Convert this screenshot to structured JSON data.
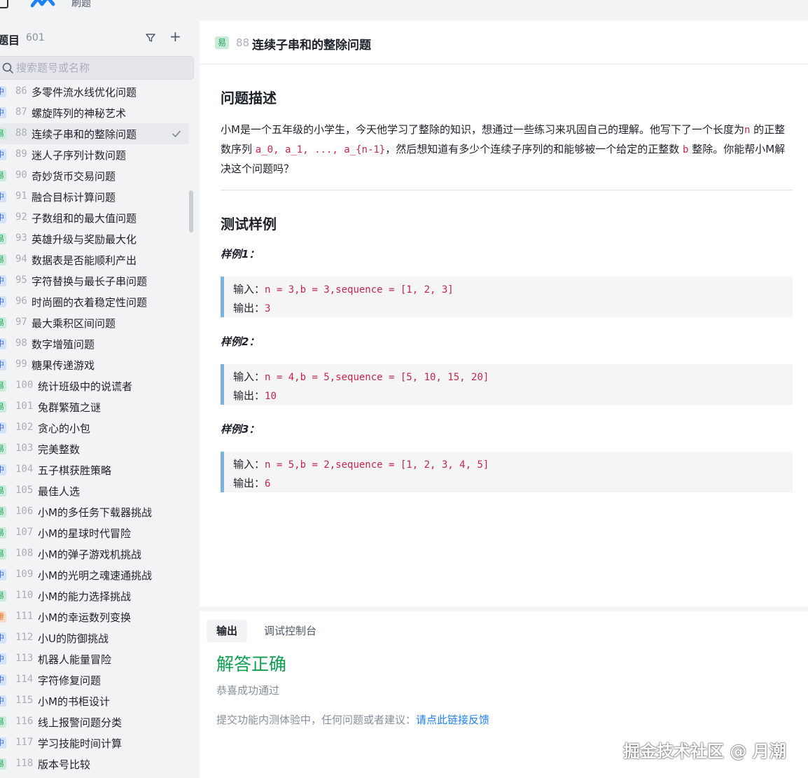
{
  "app": {
    "title": "刷题"
  },
  "sidebar": {
    "title": "题目",
    "count": "601",
    "search_placeholder": "搜索题号或名称",
    "items": [
      {
        "num": "86",
        "name": "多零件流水线优化问题",
        "diff": "中",
        "level": "mid"
      },
      {
        "num": "87",
        "name": "螺旋阵列的神秘艺术",
        "diff": "中",
        "level": "mid"
      },
      {
        "num": "88",
        "name": "连续子串和的整除问题",
        "diff": "易",
        "level": "easy",
        "active": true
      },
      {
        "num": "89",
        "name": "迷人子序列计数问题",
        "diff": "中",
        "level": "mid"
      },
      {
        "num": "90",
        "name": "奇妙货币交易问题",
        "diff": "易",
        "level": "easy"
      },
      {
        "num": "91",
        "name": "融合目标计算问题",
        "diff": "中",
        "level": "mid"
      },
      {
        "num": "92",
        "name": "子数组和的最大值问题",
        "diff": "中",
        "level": "mid"
      },
      {
        "num": "93",
        "name": "英雄升级与奖励最大化",
        "diff": "易",
        "level": "easy"
      },
      {
        "num": "94",
        "name": "数据表是否能顺利产出",
        "diff": "易",
        "level": "easy"
      },
      {
        "num": "95",
        "name": "字符替换与最长子串问题",
        "diff": "中",
        "level": "mid"
      },
      {
        "num": "96",
        "name": "时尚圈的衣着稳定性问题",
        "diff": "中",
        "level": "mid"
      },
      {
        "num": "97",
        "name": "最大乘积区间问题",
        "diff": "易",
        "level": "easy"
      },
      {
        "num": "98",
        "name": "数字增殖问题",
        "diff": "中",
        "level": "mid"
      },
      {
        "num": "99",
        "name": "糖果传递游戏",
        "diff": "中",
        "level": "mid"
      },
      {
        "num": "100",
        "name": "统计班级中的说谎者",
        "diff": "易",
        "level": "easy"
      },
      {
        "num": "101",
        "name": "兔群繁殖之谜",
        "diff": "易",
        "level": "easy"
      },
      {
        "num": "102",
        "name": "贪心的小包",
        "diff": "中",
        "level": "mid"
      },
      {
        "num": "103",
        "name": "完美整数",
        "diff": "易",
        "level": "easy"
      },
      {
        "num": "104",
        "name": "五子棋获胜策略",
        "diff": "中",
        "level": "mid"
      },
      {
        "num": "105",
        "name": "最佳人选",
        "diff": "易",
        "level": "easy"
      },
      {
        "num": "106",
        "name": "小M的多任务下载器挑战",
        "diff": "易",
        "level": "easy"
      },
      {
        "num": "107",
        "name": "小M的星球时代冒险",
        "diff": "易",
        "level": "easy"
      },
      {
        "num": "108",
        "name": "小M的弹子游戏机挑战",
        "diff": "易",
        "level": "easy"
      },
      {
        "num": "109",
        "name": "小M的光明之魂速通挑战",
        "diff": "中",
        "level": "mid"
      },
      {
        "num": "110",
        "name": "小M的能力选择挑战",
        "diff": "易",
        "level": "easy"
      },
      {
        "num": "111",
        "name": "小M的幸运数列变换",
        "diff": "难",
        "level": "hard"
      },
      {
        "num": "112",
        "name": "小U的防御挑战",
        "diff": "中",
        "level": "mid"
      },
      {
        "num": "113",
        "name": "机器人能量冒险",
        "diff": "中",
        "level": "mid"
      },
      {
        "num": "114",
        "name": "字符修复问题",
        "diff": "中",
        "level": "mid"
      },
      {
        "num": "115",
        "name": "小M的书柜设计",
        "diff": "中",
        "level": "mid"
      },
      {
        "num": "116",
        "name": "线上报警问题分类",
        "diff": "易",
        "level": "easy"
      },
      {
        "num": "117",
        "name": "学习技能时间计算",
        "diff": "中",
        "level": "mid"
      },
      {
        "num": "118",
        "name": "版本号比较",
        "diff": "易",
        "level": "easy"
      }
    ]
  },
  "problem": {
    "diff": "易",
    "num": "88",
    "title": "连续子串和的整除问题",
    "desc_heading": "问题描述",
    "desc_1": "小M是一个五年级的小学生，今天他学习了整除的知识，想通过一些练习来巩固自己的理解。他写下了一个长度为",
    "desc_n": "n",
    "desc_2": "的正整数序列",
    "desc_seq": "a_0, a_1, ..., a_{n-1}",
    "desc_3": "，然后想知道有多少个连续子序列的和能够被一个给定的正整数",
    "desc_b": "b",
    "desc_4": "整除。你能帮小M解决这个问题吗？",
    "tests_heading": "测试样例",
    "examples": [
      {
        "label": "样例1：",
        "input_label": "输入：",
        "input": "n = 3,b = 3,sequence = [1, 2, 3]",
        "output_label": "输出：",
        "output": "3"
      },
      {
        "label": "样例2：",
        "input_label": "输入：",
        "input": "n = 4,b = 5,sequence = [5, 10, 15, 20]",
        "output_label": "输出：",
        "output": "10"
      },
      {
        "label": "样例3：",
        "input_label": "输入：",
        "input": "n = 5,b = 2,sequence = [1, 2, 3, 4, 5]",
        "output_label": "输出：",
        "output": "6"
      }
    ]
  },
  "console": {
    "tab_output": "输出",
    "tab_debug": "调试控制台",
    "result": "解答正确",
    "result_sub": "恭喜成功通过",
    "feedback_text": "提交功能内测体验中，任何问题或者建议：",
    "feedback_link": "请点此链接反馈",
    "watermark": "掘金技术社区 @ 月潮"
  }
}
